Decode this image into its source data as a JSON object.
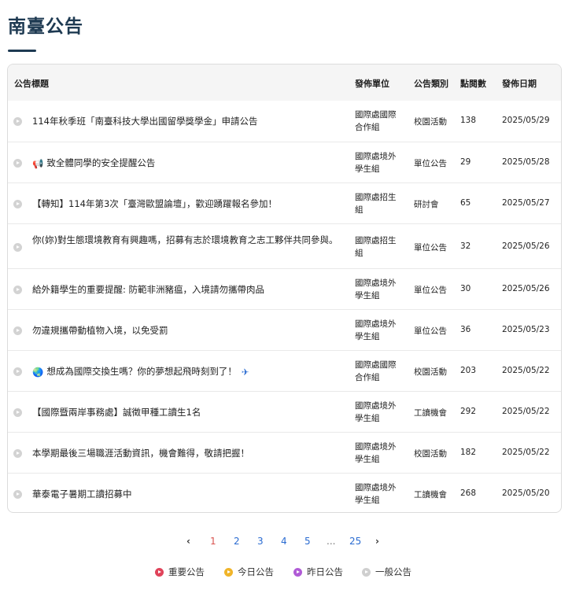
{
  "page": {
    "title": "南臺公告"
  },
  "table": {
    "headers": {
      "title": "公告標題",
      "unit": "發佈單位",
      "category": "公告類別",
      "views": "點閱數",
      "date": "發佈日期"
    },
    "rows": [
      {
        "title": "114年秋季班「南臺科技大學出國留學獎學金」申請公告",
        "unit": "國際處國際合作組",
        "category": "校園活動",
        "views": "138",
        "date": "2025/05/29"
      },
      {
        "title": "致全體同學的安全提醒公告",
        "icon": "megaphone-icon",
        "unit": "國際處境外學生組",
        "category": "單位公告",
        "views": "29",
        "date": "2025/05/28"
      },
      {
        "title": "【轉知】114年第3次「臺灣歐盟論壇」，歡迎踴躍報名參加！",
        "unit": "國際處招生組",
        "category": "研討會",
        "views": "65",
        "date": "2025/05/27"
      },
      {
        "title": "你(妳)對生態環境教育有興趣嗎，招募有志於環境教育之志工夥伴共同參與。",
        "unit": "國際處招生組",
        "category": "單位公告",
        "views": "32",
        "date": "2025/05/26"
      },
      {
        "title": "給外籍學生的重要提醒: 防範非洲豬瘟，入境請勿攜帶肉品",
        "unit": "國際處境外學生組",
        "category": "單位公告",
        "views": "30",
        "date": "2025/05/26"
      },
      {
        "title": "勿違規攜帶動植物入境，以免受罰",
        "unit": "國際處境外學生組",
        "category": "單位公告",
        "views": "36",
        "date": "2025/05/23"
      },
      {
        "title": "想成為國際交換生嗎？你的夢想起飛時刻到了！",
        "icon": "globe-icon",
        "icon_after": "airplane-icon",
        "unit": "國際處國際合作組",
        "category": "校園活動",
        "views": "203",
        "date": "2025/05/22"
      },
      {
        "title": "【國際暨兩岸事務處】誠徵甲種工讀生1名",
        "unit": "國際處境外學生組",
        "category": "工讀機會",
        "views": "292",
        "date": "2025/05/22"
      },
      {
        "title": "本學期最後三場職涯活動資訊，機會難得，敬請把握！",
        "unit": "國際處境外學生組",
        "category": "校園活動",
        "views": "182",
        "date": "2025/05/22"
      },
      {
        "title": "華泰電子暑期工讀招募中",
        "unit": "國際處境外學生組",
        "category": "工讀機會",
        "views": "268",
        "date": "2025/05/20"
      }
    ]
  },
  "pagination": {
    "prev": "‹",
    "pages": [
      "1",
      "2",
      "3",
      "4",
      "5"
    ],
    "ellipsis": "...",
    "last": "25",
    "next": "›",
    "current": "1"
  },
  "legend": [
    {
      "label": "重要公告",
      "color": "#e0435a"
    },
    {
      "label": "今日公告",
      "color": "#f0b429"
    },
    {
      "label": "昨日公告",
      "color": "#b05bd6"
    },
    {
      "label": "一般公告",
      "color": "#cfcfcf"
    }
  ]
}
